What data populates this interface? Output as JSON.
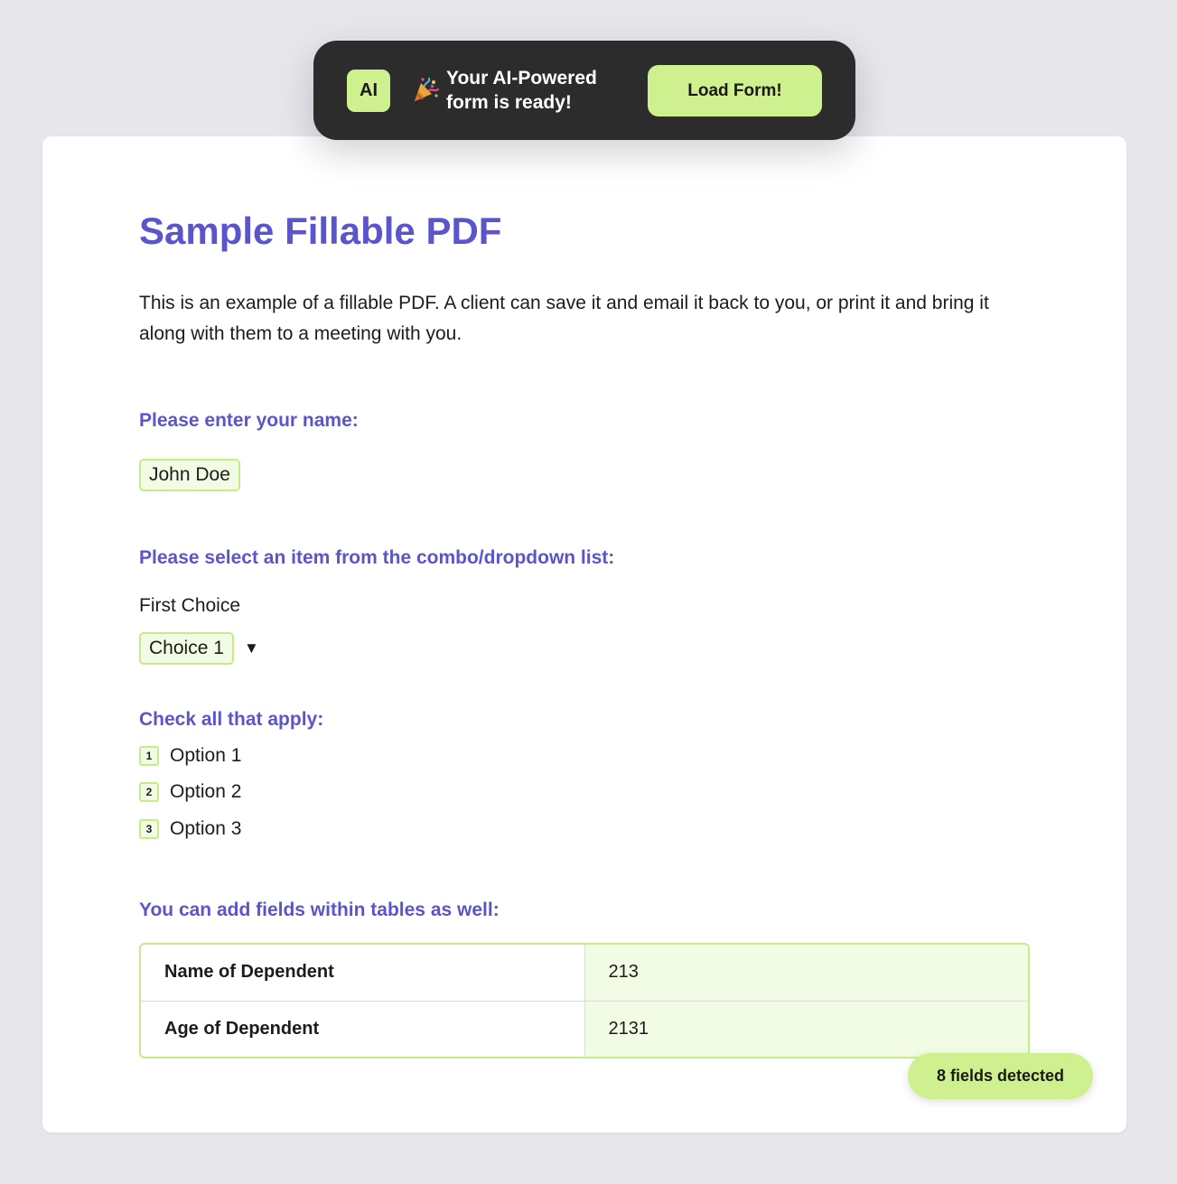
{
  "toast": {
    "badge": "AI",
    "icon": "party-popper-icon",
    "message": "Your AI-Powered form is ready!",
    "action_label": "Load Form!"
  },
  "document": {
    "title": "Sample Fillable PDF",
    "intro": "This is an example of a fillable PDF. A client can save it and email it back to you, or print it and bring it along with them to a meeting with you.",
    "name_section": {
      "label": "Please enter your name:",
      "value": "John Doe"
    },
    "dropdown_section": {
      "label": "Please select an item from the combo/dropdown list:",
      "caption": "First Choice",
      "selected": "Choice 1",
      "arrow": "▼"
    },
    "checkbox_section": {
      "label": "Check all that apply:",
      "options": [
        {
          "marker": "1",
          "label": "Option 1"
        },
        {
          "marker": "2",
          "label": "Option 2"
        },
        {
          "marker": "3",
          "label": "Option 3"
        }
      ]
    },
    "table_section": {
      "label": "You can add fields within tables as well:",
      "rows": [
        {
          "label": "Name of Dependent",
          "value": "213"
        },
        {
          "label": "Age of Dependent",
          "value": "2131"
        }
      ]
    }
  },
  "status": {
    "fields_detected": "8 fields detected"
  },
  "colors": {
    "accent": "#5b55cc",
    "highlight": "#cff08f",
    "field_fill": "#f2fbe4",
    "toast_bg": "#2c2c2c",
    "page_bg": "#e6e6eb"
  }
}
